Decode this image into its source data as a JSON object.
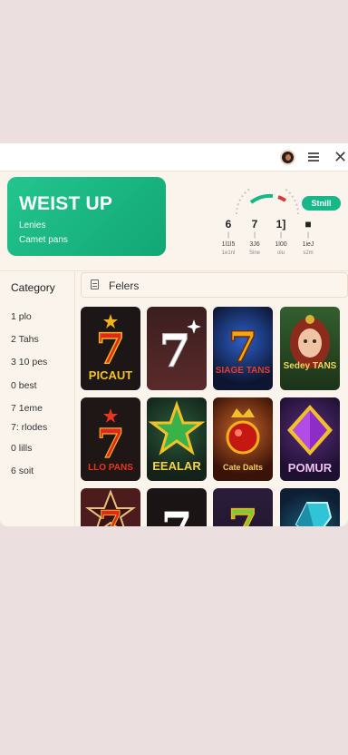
{
  "header": {
    "menu_icon": "hamburger-icon",
    "close_icon": "close-icon",
    "close_glyph": "✕"
  },
  "banner": {
    "title": "WEIST UP",
    "line1": "Lenies",
    "line2": "Camet pans",
    "color": "#17b887"
  },
  "gauge": {
    "start_label": "Stnill"
  },
  "stats": [
    {
      "value": "6",
      "tick": "|",
      "label": "1l1l5",
      "caption": "1e1nl"
    },
    {
      "value": "7",
      "tick": "|",
      "label": "3J6",
      "caption": "Sine"
    },
    {
      "value": "1]",
      "tick": "|",
      "label": "1l00",
      "caption": "olu"
    },
    {
      "value": "■",
      "tick": "|",
      "label": "1ieJ",
      "caption": "s2m"
    }
  ],
  "sidebar": {
    "title": "Category",
    "items": [
      {
        "label": "1 plo"
      },
      {
        "label": "2 Tahs"
      },
      {
        "label": "3 10 pes"
      },
      {
        "label": "0 best"
      },
      {
        "label": "7 1eme"
      },
      {
        "label": "7: rlodes"
      },
      {
        "label": "0 lills"
      },
      {
        "label": "6 soit"
      }
    ]
  },
  "filter": {
    "label": "Felers"
  },
  "games": [
    {
      "label": "PICAUT"
    },
    {
      "label": ""
    },
    {
      "label": "SIAGE TANS"
    },
    {
      "label": "Sedey TANS"
    },
    {
      "label": "LLO PANS"
    },
    {
      "label": "EEALAR"
    },
    {
      "label": "Cate Dalts"
    },
    {
      "label": "POMUR"
    },
    {
      "label": ""
    },
    {
      "label": ""
    },
    {
      "label": ""
    },
    {
      "label": ""
    }
  ],
  "colors": {
    "accent": "#17b887",
    "background": "#ebe0df",
    "panel": "#fbf4ec"
  }
}
